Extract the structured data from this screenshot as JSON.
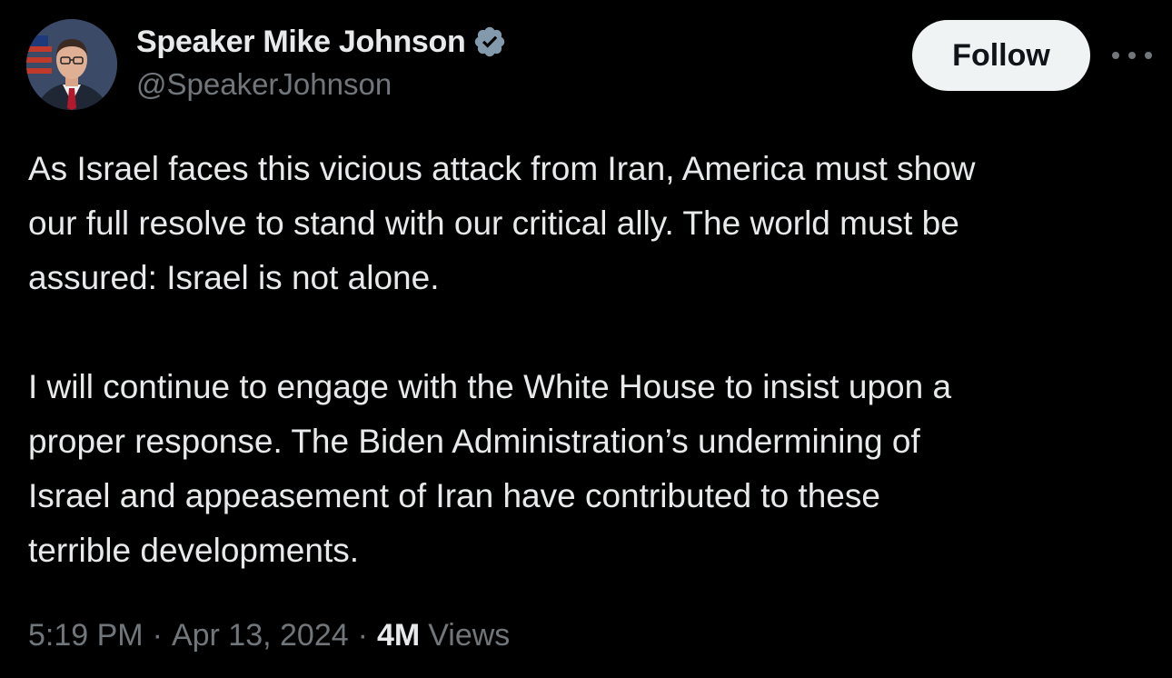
{
  "author": {
    "display_name": "Speaker Mike Johnson",
    "handle": "@SpeakerJohnson",
    "verified_badge_color": "#829aab"
  },
  "follow_button_label": "Follow",
  "more_icon": "more-horizontal-icon",
  "tweet": {
    "lines_paragraph_1": [
      "As Israel faces this vicious attack from Iran, America must show",
      "our full resolve to stand with our critical ally. The world must be",
      "assured: Israel is not alone."
    ],
    "lines_paragraph_2": [
      "I will continue to engage with the White House to insist upon a",
      "proper response. The Biden Administration’s undermining of",
      "Israel and appeasement of Iran have contributed to these",
      "terrible developments."
    ]
  },
  "meta": {
    "time": "5:19 PM",
    "separator": "·",
    "date": "Apr 13, 2024",
    "views_count": "4M",
    "views_label": "Views"
  },
  "colors": {
    "background": "#000000",
    "primary_text": "#e7e9ea",
    "secondary_text": "#71767b",
    "follow_button_bg": "#eff3f4"
  }
}
